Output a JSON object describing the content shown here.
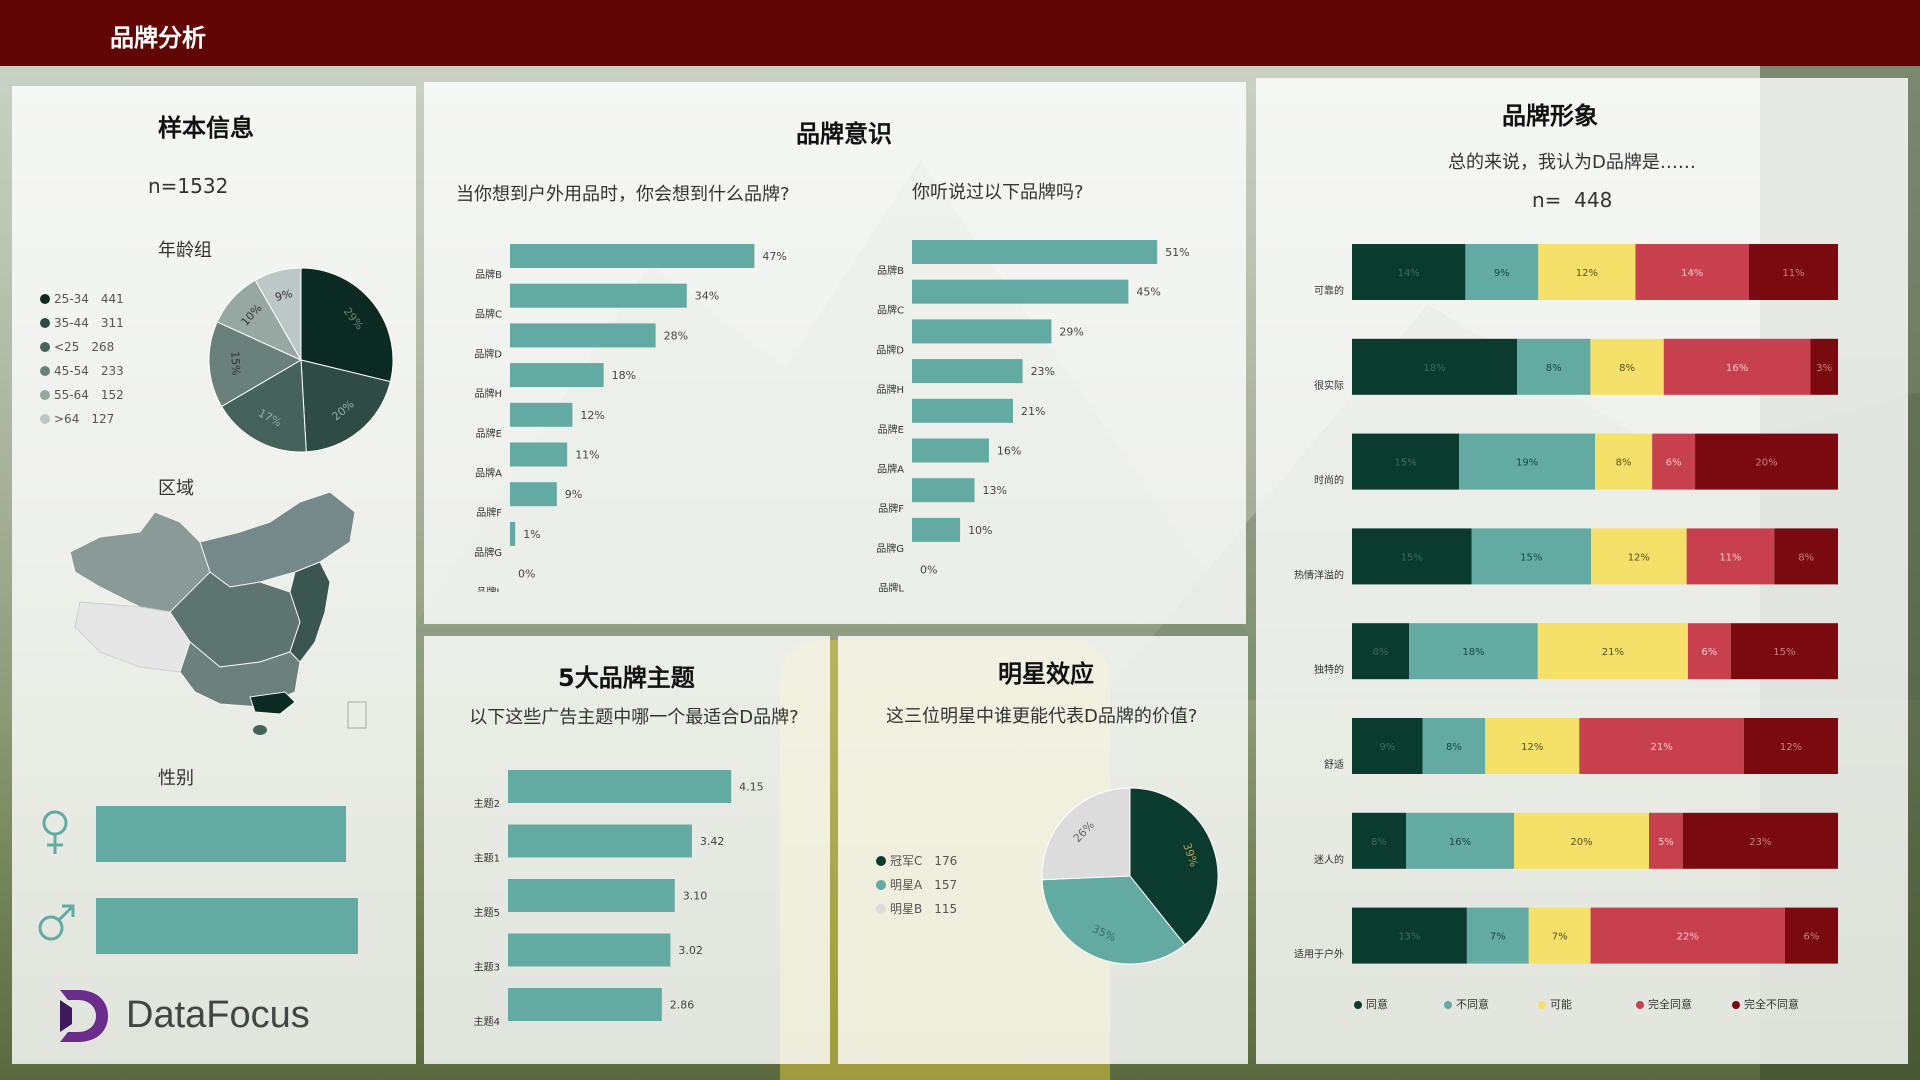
{
  "header": {
    "title": "品牌分析"
  },
  "sample": {
    "title": "样本信息",
    "n_label": "n=1532",
    "age_title": "年龄组",
    "region_title": "区域",
    "gender_title": "性别",
    "age_legend": [
      {
        "label": "25-34",
        "count": "441",
        "color": "#0b2a22"
      },
      {
        "label": "35-44",
        "count": "311",
        "color": "#2e4c45"
      },
      {
        "label": "<25",
        "count": "268",
        "color": "#45625b"
      },
      {
        "label": "45-54",
        "count": "233",
        "color": "#6a807a"
      },
      {
        "label": "55-64",
        "count": "152",
        "color": "#97a8a3"
      },
      {
        "label": ">64",
        "count": "127",
        "color": "#bcc8c5"
      }
    ],
    "gender": {
      "female_icon": "female-symbol-icon",
      "male_icon": "male-symbol-icon",
      "bar_color": "#62aaa2"
    },
    "logo": "DataFocus"
  },
  "awareness": {
    "title": "品牌意识",
    "q1": "当你想到户外用品时，你会想到什么品牌?",
    "q2": "你听说过以下品牌吗?"
  },
  "themes": {
    "title": "5大品牌主题",
    "question": "以下这些广告主题中哪一个最适合D品牌?"
  },
  "star": {
    "title": "明星效应",
    "question": "这三位明星中谁更能代表D品牌的价值?"
  },
  "image": {
    "title": "品牌形象",
    "question": "总的来说，我认为D品牌是……",
    "n_label": "n=",
    "n_value": "448"
  },
  "chart_data": [
    {
      "id": "age",
      "type": "pie",
      "categories": [
        "25-34",
        "35-44",
        "<25",
        "45-54",
        "55-64",
        ">64"
      ],
      "values": [
        441,
        311,
        268,
        233,
        152,
        127
      ],
      "slice_labels": [
        "29%",
        "20%",
        "17%",
        "15%",
        "10%",
        "9%"
      ],
      "colors": [
        "#0b2a22",
        "#2e4c45",
        "#45625b",
        "#6a807a",
        "#97a8a3",
        "#bcc8c5"
      ]
    },
    {
      "id": "unaided",
      "type": "bar",
      "orientation": "horizontal",
      "categories": [
        "品牌B",
        "品牌C",
        "品牌D",
        "品牌H",
        "品牌E",
        "品牌A",
        "品牌F",
        "品牌G",
        "品牌L"
      ],
      "values": [
        47,
        34,
        28,
        18,
        12,
        11,
        9,
        1,
        0
      ],
      "value_suffix": "%",
      "max": 50,
      "color": "#62aaa2"
    },
    {
      "id": "aided",
      "type": "bar",
      "orientation": "horizontal",
      "categories": [
        "品牌B",
        "品牌C",
        "品牌D",
        "品牌H",
        "品牌E",
        "品牌A",
        "品牌F",
        "品牌G",
        "品牌L"
      ],
      "values": [
        51,
        45,
        29,
        23,
        21,
        16,
        13,
        10,
        0
      ],
      "value_suffix": "%",
      "max": 52,
      "color": "#62aaa2"
    },
    {
      "id": "themes",
      "type": "bar",
      "orientation": "horizontal",
      "categories": [
        "主题2",
        "主题1",
        "主题5",
        "主题3",
        "主题4"
      ],
      "values": [
        4.15,
        3.42,
        3.1,
        3.02,
        2.86
      ],
      "value_labels": [
        "4.15",
        "3.42",
        "3.10",
        "3.02",
        "2.86"
      ],
      "max": 4.5,
      "color": "#62aaa2"
    },
    {
      "id": "star",
      "type": "pie",
      "categories": [
        "冠军C",
        "明星A",
        "明星B"
      ],
      "values": [
        176,
        157,
        115
      ],
      "slice_labels": [
        "39%",
        "35%",
        "26%"
      ],
      "colors": [
        "#0b3a2e",
        "#62aaa2",
        "#dcdcdc"
      ]
    },
    {
      "id": "brand_image",
      "type": "bar",
      "stacked": true,
      "orientation": "horizontal",
      "categories": [
        "可靠的",
        "很实际",
        "时尚的",
        "热情洋溢的",
        "独特的",
        "舒适",
        "迷人的",
        "适用于户外"
      ],
      "series": [
        {
          "name": "同意",
          "color": "#0b3a2e",
          "values": [
            14,
            18,
            15,
            15,
            8,
            9,
            8,
            13
          ]
        },
        {
          "name": "不同意",
          "color": "#62aaa2",
          "values": [
            9,
            8,
            19,
            15,
            18,
            8,
            16,
            7
          ]
        },
        {
          "name": "可能",
          "color": "#f5e06a",
          "values": [
            12,
            8,
            8,
            12,
            21,
            12,
            20,
            7
          ]
        },
        {
          "name": "完全同意",
          "color": "#c8404e",
          "values": [
            14,
            16,
            6,
            11,
            6,
            21,
            5,
            22
          ]
        },
        {
          "name": "完全不同意",
          "color": "#7a0a10",
          "values": [
            11,
            3,
            20,
            8,
            15,
            12,
            23,
            6
          ]
        }
      ],
      "value_suffix": "%"
    }
  ]
}
